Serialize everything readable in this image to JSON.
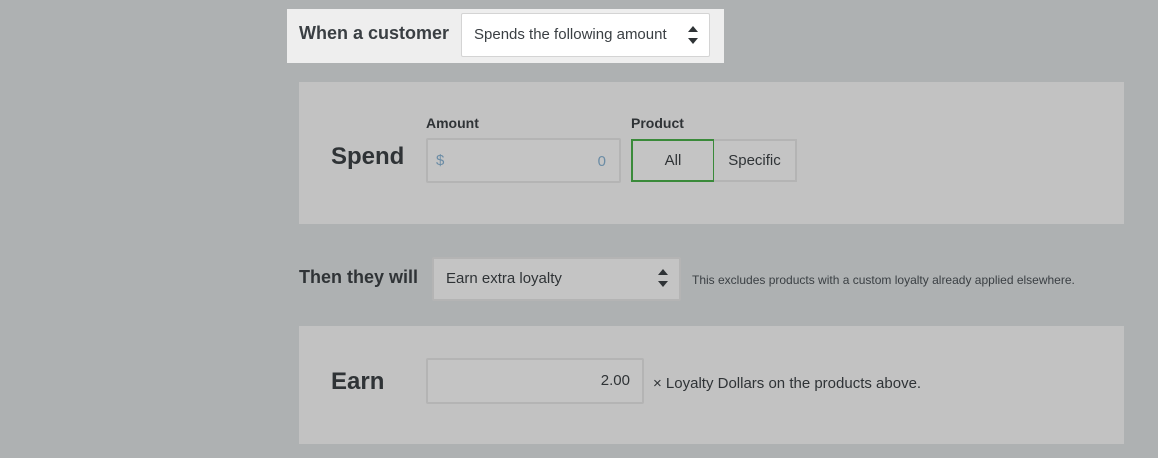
{
  "trigger": {
    "label": "When a customer",
    "select_value": "Spends the following amount"
  },
  "spend_panel": {
    "title": "Spend",
    "amount_label": "Amount",
    "amount_prefix": "$",
    "amount_value": "0",
    "product_label": "Product",
    "product_options": [
      "All",
      "Specific"
    ],
    "product_selected": "All"
  },
  "action": {
    "label": "Then they will",
    "select_value": "Earn extra loyalty",
    "hint": "This excludes products with a custom loyalty already applied elsewhere."
  },
  "earn_panel": {
    "title": "Earn",
    "value": "2.00",
    "suffix": "× Loyalty Dollars on the products above."
  },
  "colors": {
    "background": "#aeb1b2",
    "panel": "#c2c2c2",
    "selected_border": "#3a8a3a",
    "highlight": "#eeeeee"
  }
}
